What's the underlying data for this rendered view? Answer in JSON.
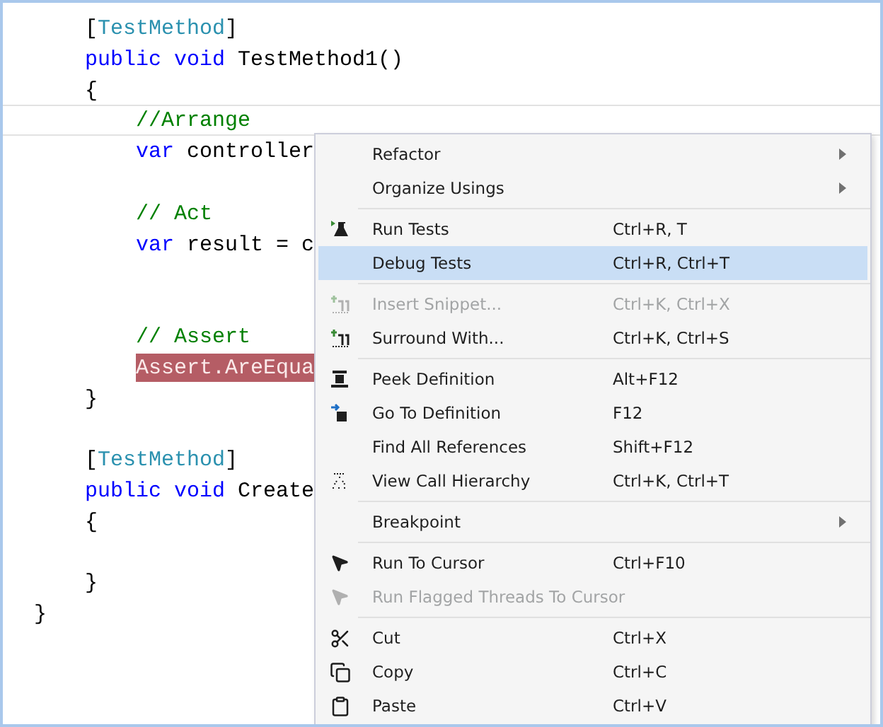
{
  "editor": {
    "lines": [
      {
        "kind": "member",
        "tokens": [
          {
            "text": "[",
            "kind": "plain"
          },
          {
            "text": "TestMethod",
            "kind": "type"
          },
          {
            "text": "]",
            "kind": "plain"
          }
        ]
      },
      {
        "kind": "member",
        "tokens": [
          {
            "text": "public void ",
            "kind": "keyword"
          },
          {
            "text": "TestMethod1()",
            "kind": "plain"
          }
        ]
      },
      {
        "kind": "member",
        "tokens": [
          {
            "text": "{",
            "kind": "plain"
          }
        ]
      },
      {
        "kind": "statement",
        "current": true,
        "tokens": [
          {
            "text": "//Arrange",
            "kind": "comment"
          }
        ]
      },
      {
        "kind": "statement",
        "tokens": [
          {
            "text": "var ",
            "kind": "keyword"
          },
          {
            "text": "controller",
            "kind": "plain"
          }
        ]
      },
      {
        "kind": "blank"
      },
      {
        "kind": "statement",
        "tokens": [
          {
            "text": "// Act",
            "kind": "comment"
          }
        ]
      },
      {
        "kind": "statement",
        "tokens": [
          {
            "text": "var ",
            "kind": "keyword"
          },
          {
            "text": "result = c",
            "kind": "plain"
          }
        ]
      },
      {
        "kind": "blank"
      },
      {
        "kind": "blank"
      },
      {
        "kind": "statement",
        "tokens": [
          {
            "text": "// Assert",
            "kind": "comment"
          }
        ]
      },
      {
        "kind": "statement",
        "highlighted": true,
        "tokens": [
          {
            "text": "Assert.AreEqua",
            "kind": "plain"
          }
        ]
      },
      {
        "kind": "member",
        "tokens": [
          {
            "text": "}",
            "kind": "plain"
          }
        ]
      },
      {
        "kind": "blank"
      },
      {
        "kind": "member",
        "tokens": [
          {
            "text": "[",
            "kind": "plain"
          },
          {
            "text": "TestMethod",
            "kind": "type"
          },
          {
            "text": "]",
            "kind": "plain"
          }
        ]
      },
      {
        "kind": "member",
        "tokens": [
          {
            "text": "public void ",
            "kind": "keyword"
          },
          {
            "text": "Create",
            "kind": "plain"
          }
        ]
      },
      {
        "kind": "member",
        "tokens": [
          {
            "text": "{",
            "kind": "plain"
          }
        ]
      },
      {
        "kind": "blank"
      },
      {
        "kind": "member",
        "tokens": [
          {
            "text": "}",
            "kind": "plain"
          }
        ]
      },
      {
        "kind": "top",
        "tokens": [
          {
            "text": "}",
            "kind": "plain"
          }
        ]
      }
    ]
  },
  "context_menu": {
    "groups": [
      [
        {
          "label": "Refactor",
          "kind": "submenu",
          "disabled": false,
          "selected": false
        },
        {
          "label": "Organize Usings",
          "kind": "submenu",
          "disabled": false,
          "selected": false
        }
      ],
      [
        {
          "label": "Run Tests",
          "shortcut": "Ctrl+R, T",
          "kind": "item",
          "disabled": false,
          "selected": false
        },
        {
          "label": "Debug Tests",
          "shortcut": "Ctrl+R, Ctrl+T",
          "kind": "item",
          "disabled": false,
          "selected": true
        }
      ],
      [
        {
          "label": "Insert Snippet...",
          "shortcut": "Ctrl+K, Ctrl+X",
          "kind": "item",
          "disabled": true,
          "selected": false
        },
        {
          "label": "Surround With...",
          "shortcut": "Ctrl+K, Ctrl+S",
          "kind": "item",
          "disabled": false,
          "selected": false
        }
      ],
      [
        {
          "label": "Peek Definition",
          "shortcut": "Alt+F12",
          "kind": "item",
          "disabled": false,
          "selected": false
        },
        {
          "label": "Go To Definition",
          "shortcut": "F12",
          "kind": "item",
          "disabled": false,
          "selected": false
        },
        {
          "label": "Find All References",
          "shortcut": "Shift+F12",
          "kind": "item",
          "disabled": false,
          "selected": false
        },
        {
          "label": "View Call Hierarchy",
          "shortcut": "Ctrl+K, Ctrl+T",
          "kind": "item",
          "disabled": false,
          "selected": false
        }
      ],
      [
        {
          "label": "Breakpoint",
          "kind": "submenu",
          "disabled": false,
          "selected": false
        }
      ],
      [
        {
          "label": "Run To Cursor",
          "shortcut": "Ctrl+F10",
          "kind": "item",
          "disabled": false,
          "selected": false
        },
        {
          "label": "Run Flagged Threads To Cursor",
          "kind": "item",
          "disabled": true,
          "selected": false
        }
      ],
      [
        {
          "label": "Cut",
          "shortcut": "Ctrl+X",
          "kind": "item",
          "disabled": false,
          "selected": false
        },
        {
          "label": "Copy",
          "shortcut": "Ctrl+C",
          "kind": "item",
          "disabled": false,
          "selected": false
        },
        {
          "label": "Paste",
          "shortcut": "Ctrl+V",
          "kind": "item",
          "disabled": false,
          "selected": false
        }
      ]
    ]
  }
}
